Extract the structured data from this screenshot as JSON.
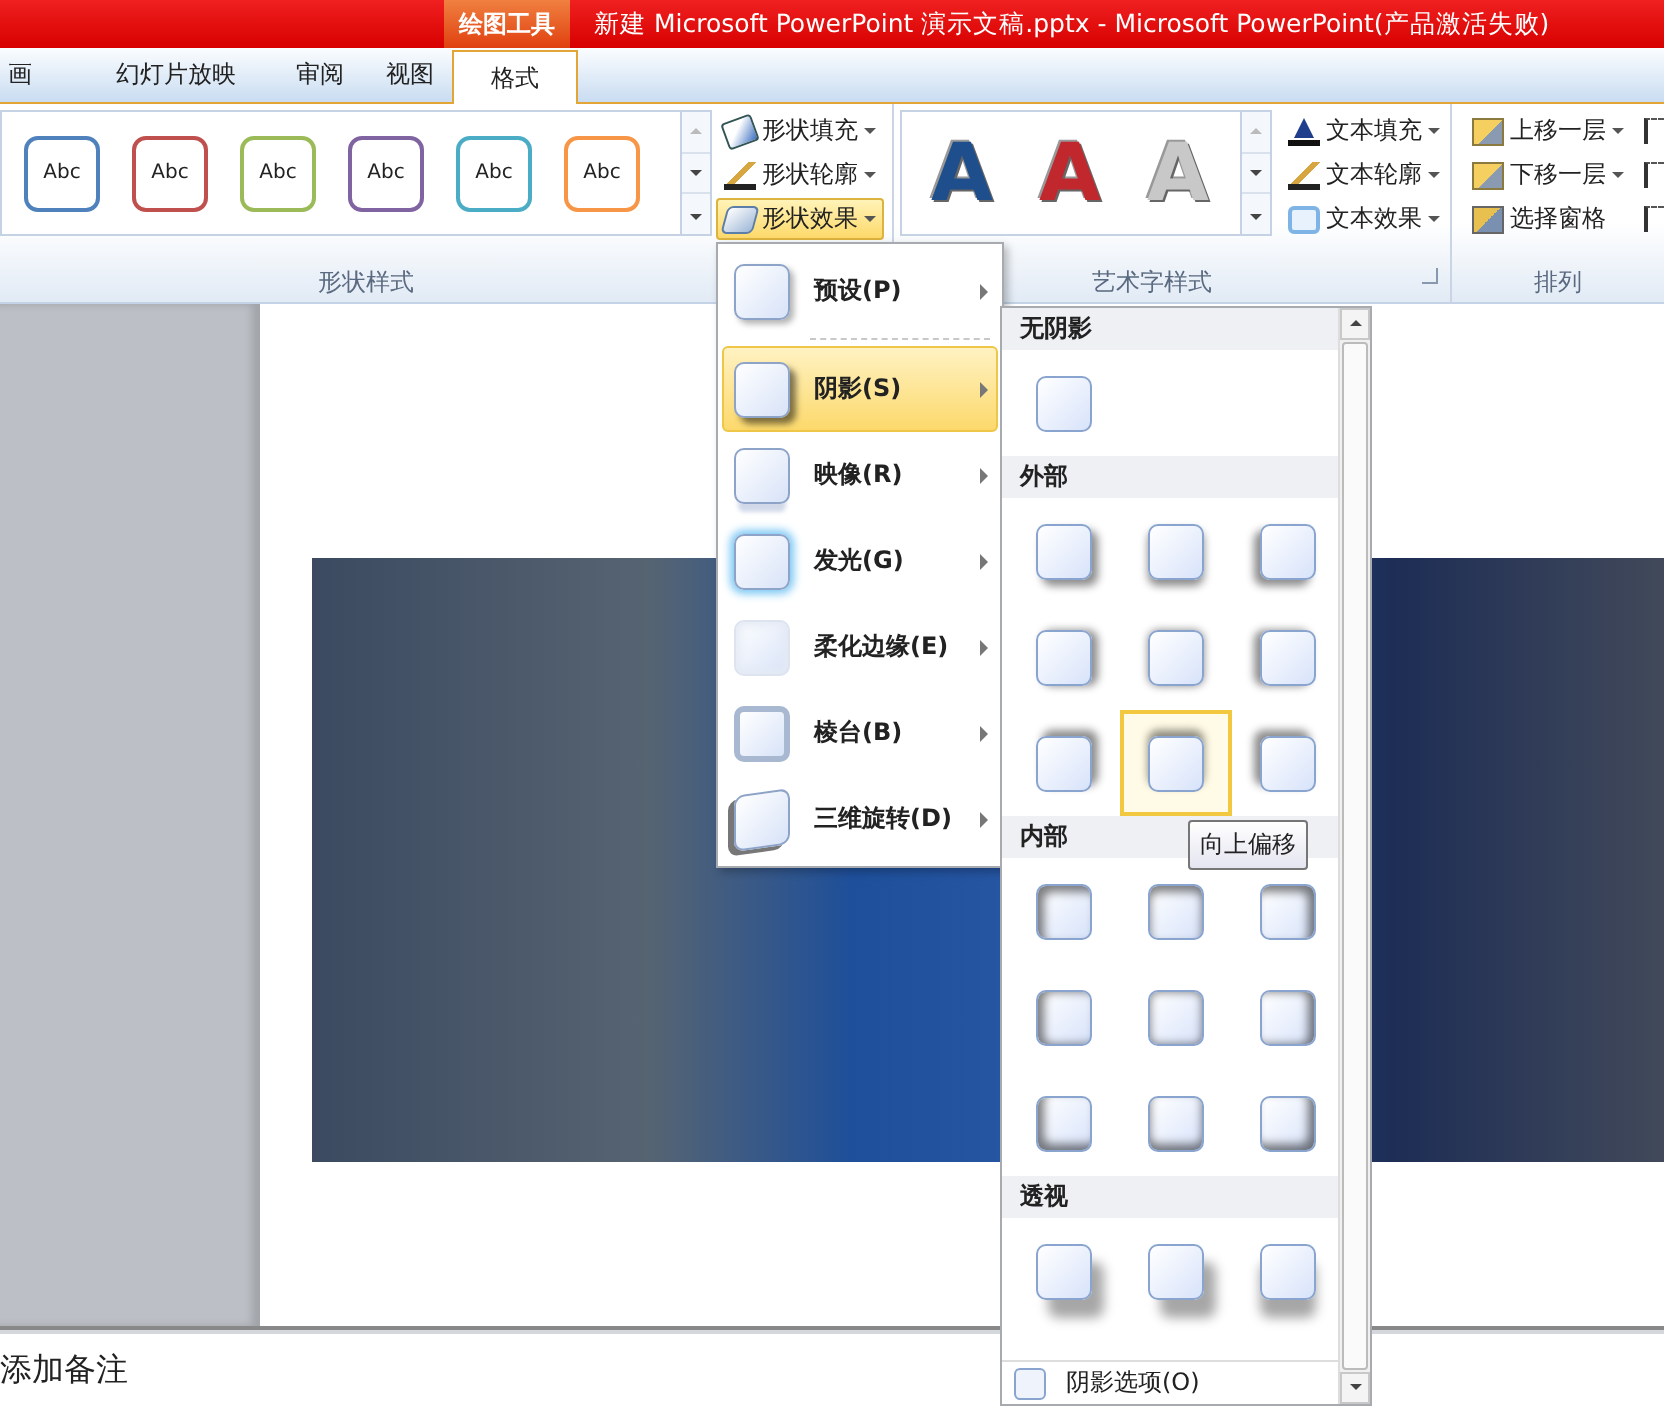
{
  "title_bar": {
    "context_tab": "绘图工具",
    "title": "新建 Microsoft PowerPoint 演示文稿.pptx  -  Microsoft PowerPoint(产品激活失败)"
  },
  "tabs": [
    {
      "label": "画",
      "selected": false
    },
    {
      "label": "幻灯片放映",
      "selected": false
    },
    {
      "label": "审阅",
      "selected": false
    },
    {
      "label": "视图",
      "selected": false
    },
    {
      "label": "格式",
      "selected": true
    }
  ],
  "ribbon": {
    "shape_styles": {
      "label": "形状样式",
      "gallery": [
        {
          "text": "Abc",
          "color": "#4f81bd"
        },
        {
          "text": "Abc",
          "color": "#c0504d"
        },
        {
          "text": "Abc",
          "color": "#9bbb59"
        },
        {
          "text": "Abc",
          "color": "#8064a2"
        },
        {
          "text": "Abc",
          "color": "#4bacc6"
        },
        {
          "text": "Abc",
          "color": "#f79646"
        }
      ],
      "commands": [
        {
          "label": "形状填充",
          "dropdown": true,
          "selected": false
        },
        {
          "label": "形状轮廓",
          "dropdown": true,
          "selected": false
        },
        {
          "label": "形状效果",
          "dropdown": true,
          "selected": true
        }
      ]
    },
    "wordart_styles": {
      "label": "艺术字样式",
      "gallery": [
        {
          "text": "A",
          "color": "#1f4e8c"
        },
        {
          "text": "A",
          "color": "#c0282d"
        },
        {
          "text": "A",
          "color": "#c8c8c8"
        }
      ],
      "commands": [
        {
          "label": "文本填充",
          "dropdown": true
        },
        {
          "label": "文本轮廓",
          "dropdown": true
        },
        {
          "label": "文本效果",
          "dropdown": true
        }
      ]
    },
    "arrange": {
      "label": "排列",
      "commands": [
        {
          "label": "上移一层",
          "dropdown": true
        },
        {
          "label": "下移一层",
          "dropdown": true
        },
        {
          "label": "选择窗格",
          "dropdown": false
        }
      ]
    }
  },
  "effects_menu": [
    {
      "label": "预设(P)",
      "selected": false
    },
    {
      "label": "阴影(S)",
      "selected": true
    },
    {
      "label": "映像(R)",
      "selected": false
    },
    {
      "label": "发光(G)",
      "selected": false
    },
    {
      "label": "柔化边缘(E)",
      "selected": false
    },
    {
      "label": "棱台(B)",
      "selected": false
    },
    {
      "label": "三维旋转(D)",
      "selected": false
    }
  ],
  "shadow_menu": {
    "sections": [
      {
        "title": "无阴影",
        "kind": "none",
        "swatches": [
          {
            "selected": false
          }
        ]
      },
      {
        "title": "外部",
        "kind": "outer",
        "swatches": [
          {
            "selected": false
          },
          {
            "selected": false
          },
          {
            "selected": false
          },
          {
            "selected": false
          },
          {
            "selected": false
          },
          {
            "selected": false
          },
          {
            "selected": false
          },
          {
            "selected": true
          },
          {
            "selected": false
          }
        ]
      },
      {
        "title": "内部",
        "kind": "inner",
        "swatches": [
          {
            "selected": false
          },
          {
            "selected": false
          },
          {
            "selected": false
          },
          {
            "selected": false
          },
          {
            "selected": false
          },
          {
            "selected": false
          },
          {
            "selected": false
          },
          {
            "selected": false
          },
          {
            "selected": false
          }
        ]
      },
      {
        "title": "透视",
        "kind": "perspective",
        "swatches": [
          {
            "selected": false
          },
          {
            "selected": false
          },
          {
            "selected": false
          }
        ]
      }
    ],
    "options": "阴影选项(O)",
    "tooltip": "向上偏移"
  },
  "notes": {
    "placeholder": "添加备注"
  }
}
